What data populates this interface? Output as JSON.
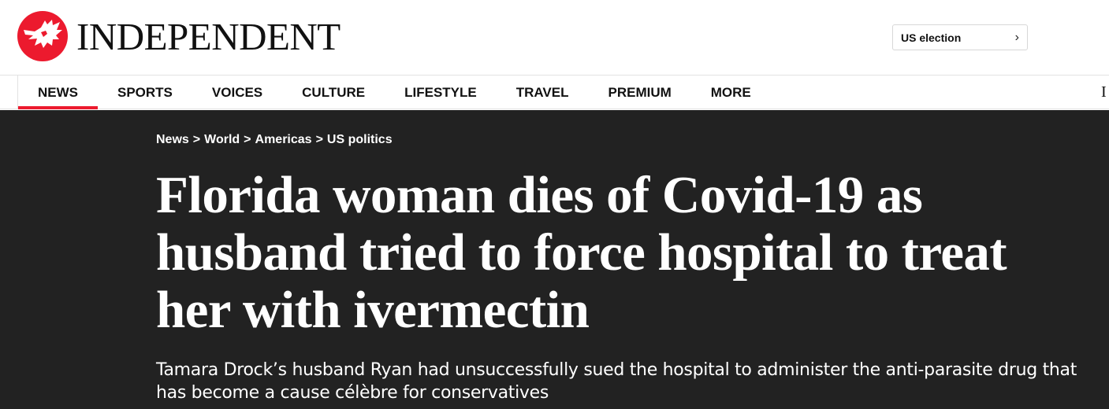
{
  "header": {
    "logo_text": "INDEPENDENT",
    "us_election_label": "US election",
    "chevron": "›"
  },
  "nav": {
    "items": [
      {
        "label": "NEWS"
      },
      {
        "label": "SPORTS"
      },
      {
        "label": "VOICES"
      },
      {
        "label": "CULTURE"
      },
      {
        "label": "LIFESTYLE"
      },
      {
        "label": "TRAVEL"
      },
      {
        "label": "PREMIUM"
      },
      {
        "label": "MORE"
      }
    ],
    "active": "NEWS",
    "overflow_glyph": "I"
  },
  "article": {
    "breadcrumb": [
      {
        "label": "News"
      },
      {
        "label": "World"
      },
      {
        "label": "Americas"
      },
      {
        "label": "US politics"
      }
    ],
    "breadcrumb_separator": ">",
    "headline": "Florida woman dies of Covid-19 as husband tried to force hospital to treat her with ivermectin",
    "standfirst": "Tamara Drock’s husband Ryan had unsuccessfully sued the hospital to administer the anti-parasite drug that has become a cause célèbre for conservatives"
  },
  "colors": {
    "brand_red": "#ec1a2e",
    "hero_bg": "#222222"
  },
  "icons": {
    "logo": "eagle-icon",
    "us_election": "chevron-right-icon"
  }
}
